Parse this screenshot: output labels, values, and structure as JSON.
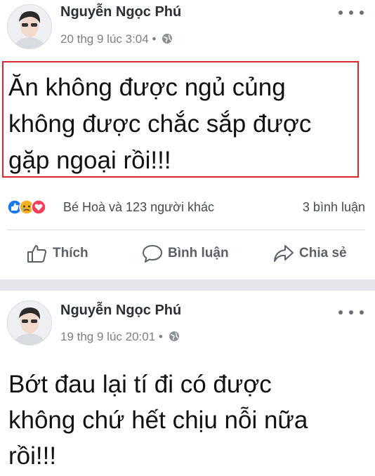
{
  "posts": [
    {
      "author": "Nguyễn Ngọc Phú",
      "timestamp": "20 thg 9 lúc 3:04",
      "separator": "•",
      "privacy_icon": "friends-globe-icon",
      "text_lines": [
        "Ăn không được ngủ củng",
        "không được chắc sắp được",
        "gặp ngoại rồi!!!"
      ],
      "reactions": {
        "icons": [
          "like-icon",
          "sad-icon",
          "love-icon"
        ],
        "summary": "Bé Hoà và 123 người khác",
        "comments": "3 bình luận"
      },
      "actions": {
        "like": "Thích",
        "comment": "Bình luận",
        "share": "Chia sẻ"
      }
    },
    {
      "author": "Nguyễn Ngọc Phú",
      "timestamp": "19 thg 9 lúc 20:01",
      "separator": "•",
      "privacy_icon": "friends-globe-icon",
      "text_lines": [
        "Bớt đau lại tí đi có được",
        "không chứ hết chịu nỗi nữa",
        "rồi!!!"
      ]
    }
  ],
  "colors": {
    "highlight_border": "#e02430",
    "like_blue": "#1877f2",
    "love_red": "#f33e58",
    "sad_yellow": "#f7b125"
  }
}
